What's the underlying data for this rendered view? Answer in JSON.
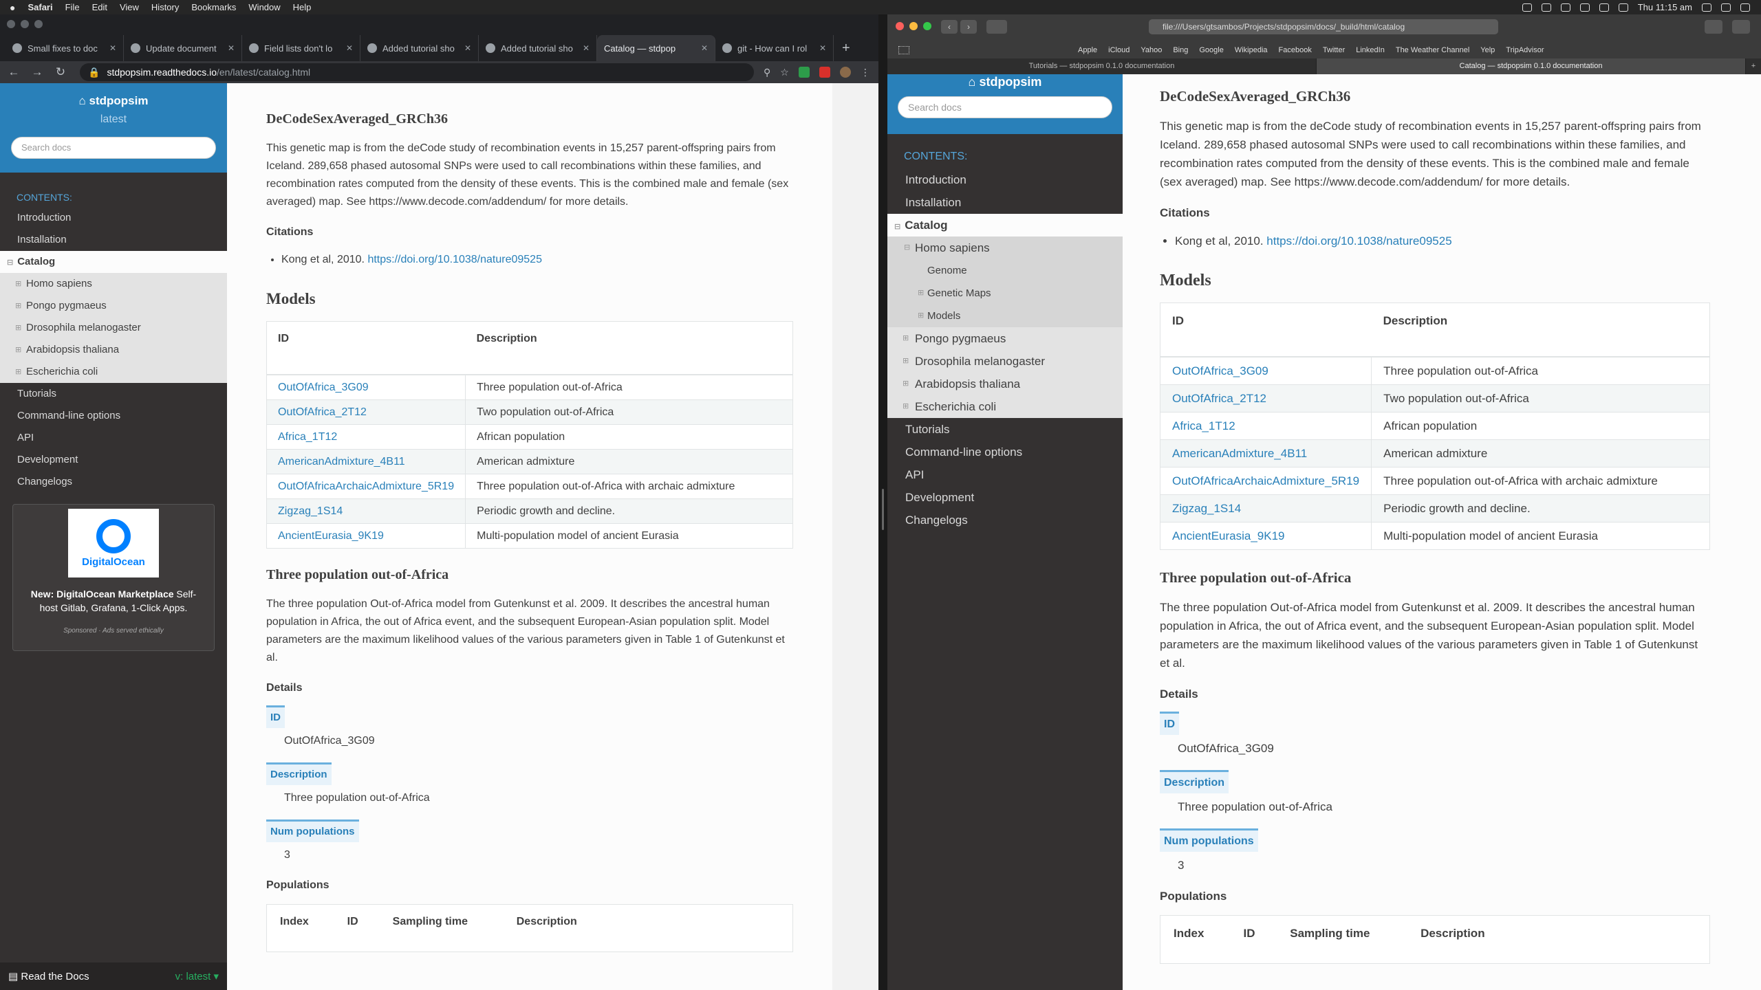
{
  "menubar": {
    "app": "Safari",
    "items": [
      "File",
      "Edit",
      "View",
      "History",
      "Bookmarks",
      "Window",
      "Help"
    ],
    "clock": "Thu 11:15 am"
  },
  "left_browser": {
    "tabs": [
      {
        "title": "Small fixes to doc"
      },
      {
        "title": "Update document"
      },
      {
        "title": "Field lists don't lo"
      },
      {
        "title": "Added tutorial sho"
      },
      {
        "title": "Added tutorial sho"
      },
      {
        "title": "Catalog — stdpop"
      },
      {
        "title": "git - How can I rol"
      }
    ],
    "url_host": "stdpopsim.readthedocs.io",
    "url_path": "/en/latest/catalog.html",
    "sidebar": {
      "project": "stdpopsim",
      "version": "latest",
      "search_placeholder": "Search docs",
      "caption": "CONTENTS:",
      "nav": {
        "introduction": "Introduction",
        "installation": "Installation",
        "catalog": "Catalog",
        "homo": "Homo sapiens",
        "pongo": "Pongo pygmaeus",
        "droso": "Drosophila melanogaster",
        "arabi": "Arabidopsis thaliana",
        "ecoli": "Escherichia coli",
        "tutorials": "Tutorials",
        "cli": "Command-line options",
        "api": "API",
        "development": "Development",
        "changelogs": "Changelogs"
      },
      "ad": {
        "brand": "DigitalOcean",
        "text_bold": "New: DigitalOcean Marketplace",
        "text_rest": " Self-host Gitlab, Grafana, 1-Click Apps.",
        "sponsored": "Sponsored · Ads served ethically"
      },
      "rtd_label": "Read the Docs",
      "rtd_version": "v: latest"
    }
  },
  "right_browser": {
    "url": "file:///Users/gtsambos/Projects/stdpopsim/docs/_build/html/catalog",
    "favorites": [
      "Apple",
      "iCloud",
      "Yahoo",
      "Bing",
      "Google",
      "Wikipedia",
      "Facebook",
      "Twitter",
      "LinkedIn",
      "The Weather Channel",
      "Yelp",
      "TripAdvisor"
    ],
    "tabs": [
      {
        "title": "Tutorials — stdpopsim 0.1.0 documentation"
      },
      {
        "title": "Catalog — stdpopsim 0.1.0 documentation"
      }
    ],
    "sidebar": {
      "project": "stdpopsim",
      "search_placeholder": "Search docs",
      "caption": "CONTENTS:",
      "nav": {
        "introduction": "Introduction",
        "installation": "Installation",
        "catalog": "Catalog",
        "homo": "Homo sapiens",
        "genome": "Genome",
        "genetic_maps": "Genetic Maps",
        "models": "Models",
        "pongo": "Pongo pygmaeus",
        "droso": "Drosophila melanogaster",
        "arabi": "Arabidopsis thaliana",
        "ecoli": "Escherichia coli",
        "tutorials": "Tutorials",
        "cli": "Command-line options",
        "api": "API",
        "development": "Development",
        "changelogs": "Changelogs"
      }
    }
  },
  "doc": {
    "map_title": "DeCodeSexAveraged_GRCh36",
    "map_desc": "This genetic map is from the deCode study of recombination events in 15,257 parent-offspring pairs from Iceland. 289,658 phased autosomal SNPs were used to call recombinations within these families, and recombination rates computed from the density of these events. This is the combined male and female (sex averaged) map. See https://www.decode.com/addendum/ for more details.",
    "citations_label": "Citations",
    "citation_text": "Kong et al, 2010. ",
    "citation_link": "https://doi.org/10.1038/nature09525",
    "models_heading": "Models",
    "models_table": {
      "headers": {
        "id": "ID",
        "desc": "Description"
      },
      "rows": [
        {
          "id": "OutOfAfrica_3G09",
          "desc": "Three population out-of-Africa"
        },
        {
          "id": "OutOfAfrica_2T12",
          "desc": "Two population out-of-Africa"
        },
        {
          "id": "Africa_1T12",
          "desc": "African population"
        },
        {
          "id": "AmericanAdmixture_4B11",
          "desc": "American admixture"
        },
        {
          "id": "OutOfAfricaArchaicAdmixture_5R19",
          "desc": "Three population out-of-Africa with archaic admixture"
        },
        {
          "id": "Zigzag_1S14",
          "desc": "Periodic growth and decline."
        },
        {
          "id": "AncientEurasia_9K19",
          "desc": "Multi-population model of ancient Eurasia"
        }
      ]
    },
    "model_heading": "Three population out-of-Africa",
    "model_desc": "The three population Out-of-Africa model from Gutenkunst et al. 2009. It describes the ancestral human population in Africa, the out of Africa event, and the subsequent European-Asian population split. Model parameters are the maximum likelihood values of the various parameters given in Table 1 of Gutenkunst et al.",
    "details_label": "Details",
    "field_id_label": "ID",
    "field_id_value": "OutOfAfrica_3G09",
    "field_desc_label": "Description",
    "field_desc_value": "Three population out-of-Africa",
    "field_num_label": "Num populations",
    "field_num_value": "3",
    "populations_label": "Populations",
    "pop_headers": {
      "index": "Index",
      "id": "ID",
      "sampling": "Sampling time",
      "desc": "Description"
    }
  }
}
